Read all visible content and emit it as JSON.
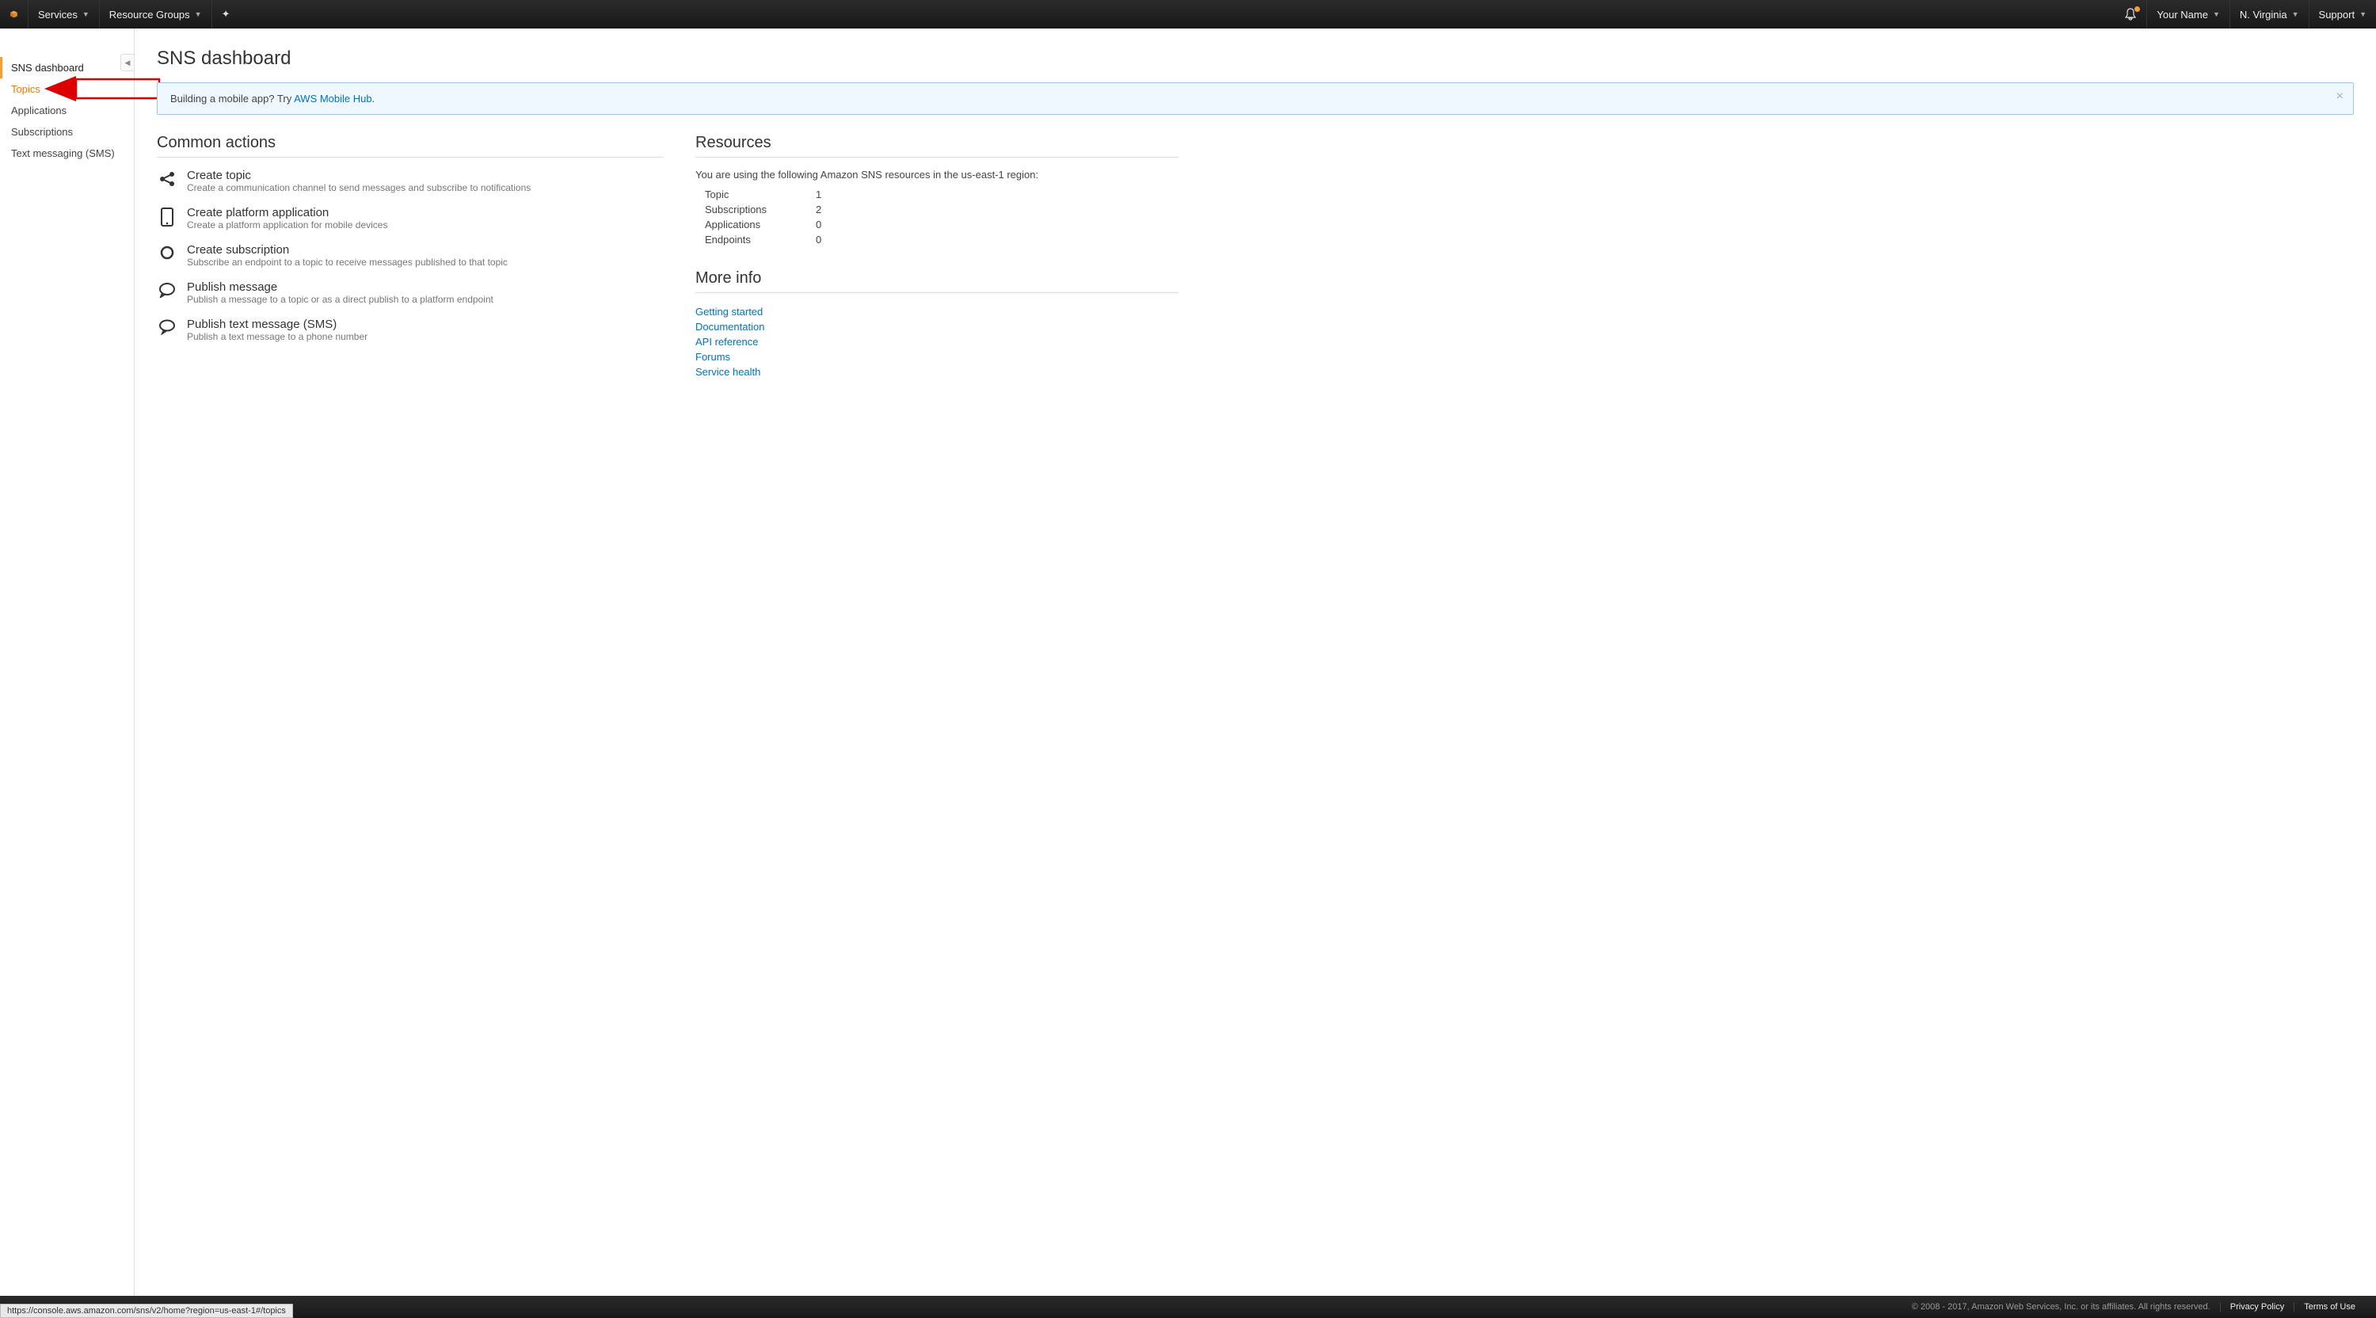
{
  "topnav": {
    "services": "Services",
    "resource_groups": "Resource Groups",
    "your_name": "Your Name",
    "region": "N. Virginia",
    "support": "Support"
  },
  "sidebar": {
    "items": [
      {
        "label": "SNS dashboard"
      },
      {
        "label": "Topics"
      },
      {
        "label": "Applications"
      },
      {
        "label": "Subscriptions"
      },
      {
        "label": "Text messaging (SMS)"
      }
    ]
  },
  "page": {
    "title": "SNS dashboard",
    "banner_text": "Building a mobile app? Try ",
    "banner_link": "AWS Mobile Hub",
    "banner_period": "."
  },
  "common_actions": {
    "heading": "Common actions",
    "items": [
      {
        "title": "Create topic",
        "desc": "Create a communication channel to send messages and subscribe to notifications"
      },
      {
        "title": "Create platform application",
        "desc": "Create a platform application for mobile devices"
      },
      {
        "title": "Create subscription",
        "desc": "Subscribe an endpoint to a topic to receive messages published to that topic"
      },
      {
        "title": "Publish message",
        "desc": "Publish a message to a topic or as a direct publish to a platform endpoint"
      },
      {
        "title": "Publish text message (SMS)",
        "desc": "Publish a text message to a phone number"
      }
    ]
  },
  "resources": {
    "heading": "Resources",
    "intro": "You are using the following Amazon SNS resources in the us-east-1 region:",
    "rows": [
      {
        "label": "Topic",
        "value": "1"
      },
      {
        "label": "Subscriptions",
        "value": "2"
      },
      {
        "label": "Applications",
        "value": "0"
      },
      {
        "label": "Endpoints",
        "value": "0"
      }
    ]
  },
  "more_info": {
    "heading": "More info",
    "links": [
      {
        "label": "Getting started"
      },
      {
        "label": "Documentation"
      },
      {
        "label": "API reference"
      },
      {
        "label": "Forums"
      },
      {
        "label": "Service health"
      }
    ]
  },
  "footer": {
    "copyright": "© 2008 - 2017, Amazon Web Services, Inc. or its affiliates. All rights reserved.",
    "privacy": "Privacy Policy",
    "terms": "Terms of Use"
  },
  "status_url": "https://console.aws.amazon.com/sns/v2/home?region=us-east-1#/topics"
}
